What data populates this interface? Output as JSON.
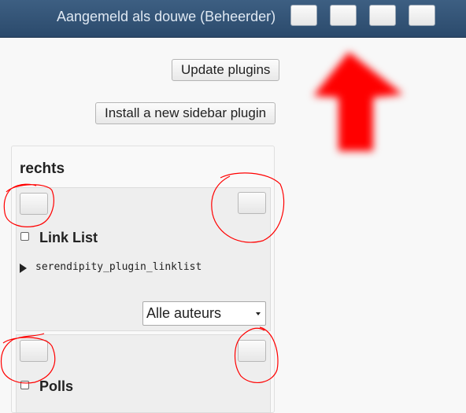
{
  "header": {
    "login_text": "Aangemeld als douwe (Beheerder)",
    "icon_buttons": [
      "toolbar-button-1",
      "toolbar-button-2",
      "toolbar-button-3",
      "toolbar-button-4"
    ]
  },
  "actions": {
    "update_plugins": "Update plugins",
    "install_sidebar_plugin": "Install a new sidebar plugin"
  },
  "column": {
    "title": "rechts",
    "plugins": [
      {
        "name": "Link List",
        "identifier": "serendipity_plugin_linklist",
        "author_select": "Alle auteurs"
      },
      {
        "name": "Polls"
      }
    ]
  },
  "annotation_color": "#ff0000"
}
